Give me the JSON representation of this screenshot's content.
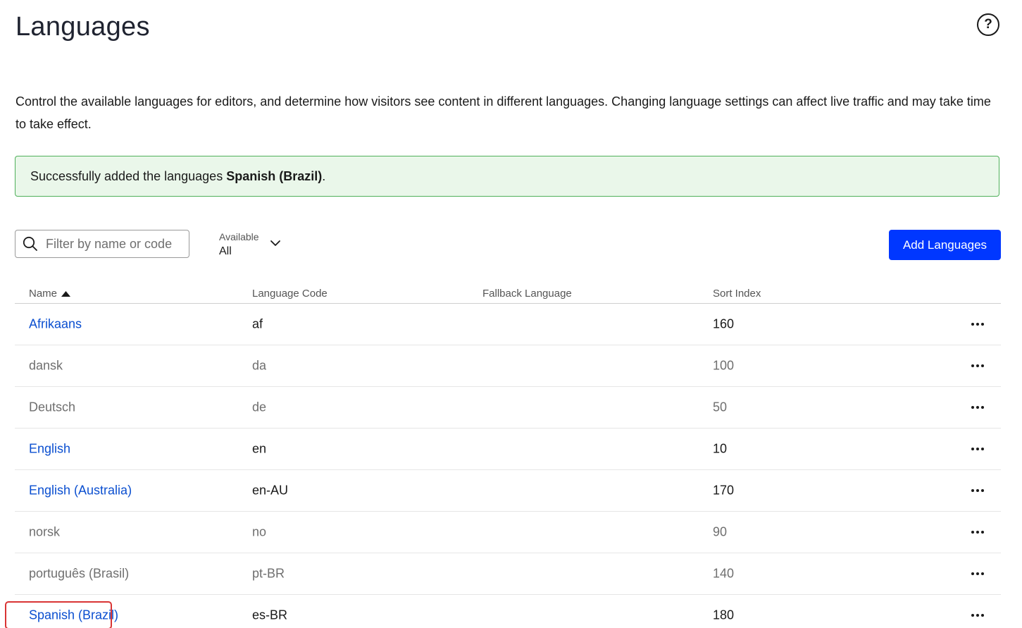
{
  "page": {
    "title": "Languages",
    "help_icon": "question-circle-icon",
    "help_glyph": "?",
    "description": "Control the available languages for editors, and determine how visitors see content in different languages. Changing language settings can affect live traffic and may take time to take effect."
  },
  "alert": {
    "prefix": "Successfully added the languages ",
    "highlight": "Spanish (Brazil)",
    "suffix": ".",
    "status_color": "#4fb05a"
  },
  "toolbar": {
    "search_placeholder": "Filter by name or code",
    "search_icon": "search-icon",
    "filter_label": "Available",
    "filter_value": "All",
    "add_button_label": "Add Languages",
    "accent_color": "#0037ff"
  },
  "table": {
    "columns": {
      "name": "Name",
      "code": "Language Code",
      "fallback": "Fallback Language",
      "sort_index": "Sort Index"
    },
    "sort": {
      "column": "name",
      "direction": "ascending"
    },
    "rows": [
      {
        "name": "Afrikaans",
        "code": "af",
        "fallback": "",
        "sort_index": "160",
        "enabled": true
      },
      {
        "name": "dansk",
        "code": "da",
        "fallback": "",
        "sort_index": "100",
        "enabled": false
      },
      {
        "name": "Deutsch",
        "code": "de",
        "fallback": "",
        "sort_index": "50",
        "enabled": false
      },
      {
        "name": "English",
        "code": "en",
        "fallback": "",
        "sort_index": "10",
        "enabled": true
      },
      {
        "name": "English (Australia)",
        "code": "en-AU",
        "fallback": "",
        "sort_index": "170",
        "enabled": true
      },
      {
        "name": "norsk",
        "code": "no",
        "fallback": "",
        "sort_index": "90",
        "enabled": false
      },
      {
        "name": "português (Brasil)",
        "code": "pt-BR",
        "fallback": "",
        "sort_index": "140",
        "enabled": false
      },
      {
        "name": "Spanish (Brazil)",
        "code": "es-BR",
        "fallback": "",
        "sort_index": "180",
        "enabled": true,
        "highlighted": true
      }
    ]
  }
}
